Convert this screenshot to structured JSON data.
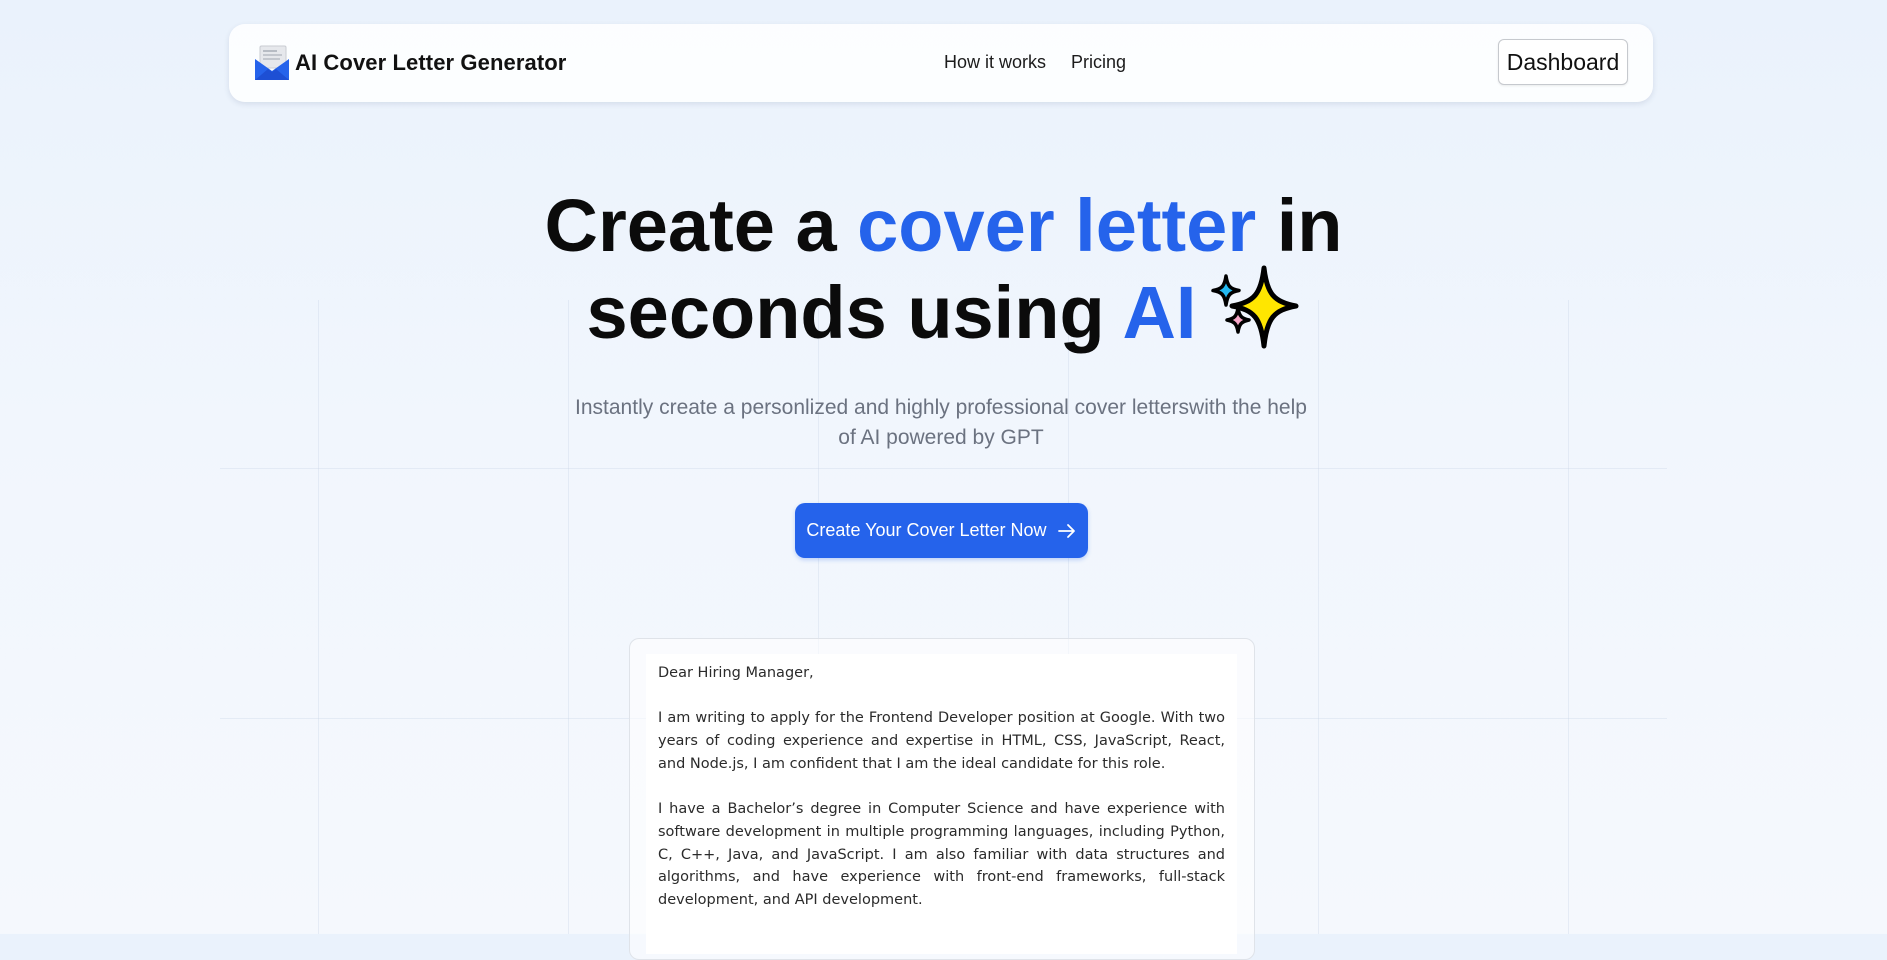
{
  "nav": {
    "brand_title": "AI Cover Letter Generator",
    "brand_icon": "envelope-letter-icon",
    "links": [
      {
        "label": "How it works"
      },
      {
        "label": "Pricing"
      }
    ],
    "dashboard_label": "Dashboard"
  },
  "hero": {
    "title_part1": "Create a ",
    "title_accent1": "cover letter",
    "title_part2": " in",
    "title_line2": "seconds using ",
    "title_accent2": "AI",
    "sparkle_icon": "sparkles-icon",
    "subtitle": "Instantly create a personlized and highly professional cover letterswith the help of AI powered by GPT",
    "cta_label": "Create Your Cover Letter Now",
    "cta_icon": "arrow-right-icon"
  },
  "letter": {
    "greeting": "Dear Hiring Manager,",
    "paragraphs": [
      "I am writing to apply for the Frontend Developer position at Google. With two years of coding experience and expertise in HTML, CSS, JavaScript, React, and Node.js, I am confident that I am the ideal candidate for this role.",
      "I have a Bachelor’s degree in Computer Science and have experience with software development in multiple programming languages, including Python, C, C++, Java, and JavaScript. I am also familiar with data structures and algorithms, and have experience with front-end frameworks, full-stack development, and API development."
    ]
  },
  "colors": {
    "accent": "#2563eb",
    "subtitle": "#6b7280",
    "background": "#eef4fc"
  }
}
